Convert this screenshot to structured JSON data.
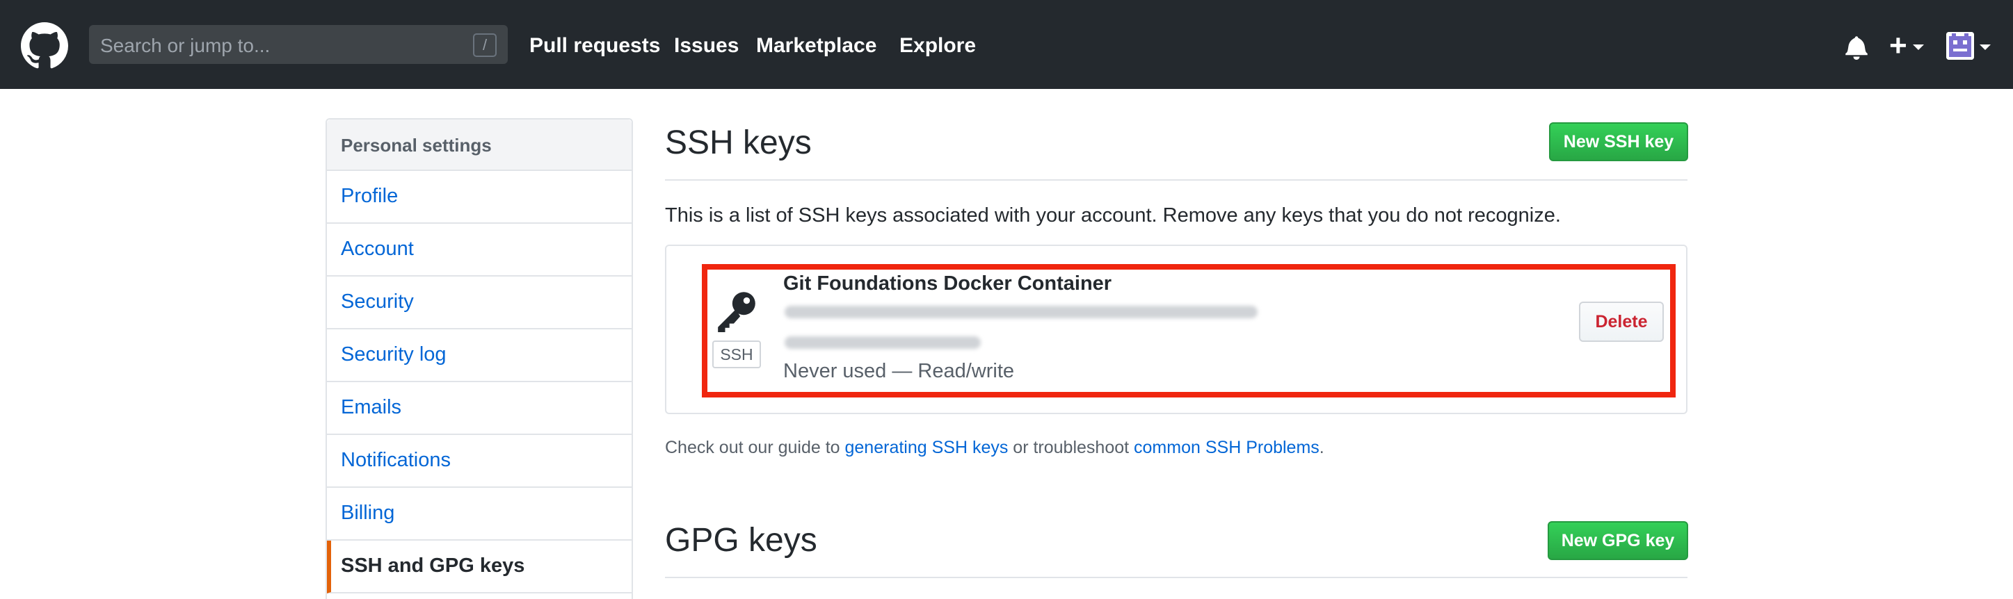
{
  "header": {
    "search_placeholder": "Search or jump to...",
    "search_shortcut": "/",
    "nav": [
      "Pull requests",
      "Issues",
      "Marketplace",
      "Explore"
    ],
    "plus_label": "+",
    "background": "#24292e"
  },
  "sidebar": {
    "heading": "Personal settings",
    "items": [
      {
        "label": "Profile",
        "selected": false
      },
      {
        "label": "Account",
        "selected": false
      },
      {
        "label": "Security",
        "selected": false
      },
      {
        "label": "Security log",
        "selected": false
      },
      {
        "label": "Emails",
        "selected": false
      },
      {
        "label": "Notifications",
        "selected": false
      },
      {
        "label": "Billing",
        "selected": false
      },
      {
        "label": "SSH and GPG keys",
        "selected": true
      }
    ],
    "selected_accent": "#e36209"
  },
  "ssh": {
    "title": "SSH keys",
    "new_button": "New SSH key",
    "description": "This is a list of SSH keys associated with your account. Remove any keys that you do not recognize.",
    "key": {
      "name": "Git Foundations Docker Container",
      "badge": "SSH",
      "usage": "Never used — Read/write",
      "delete_label": "Delete",
      "highlight_color": "#f0260f"
    },
    "guide": {
      "prefix": "Check out our guide to ",
      "link1": "generating SSH keys",
      "middle": " or troubleshoot ",
      "link2": "common SSH Problems",
      "suffix": "."
    }
  },
  "gpg": {
    "title": "GPG keys",
    "new_button": "New GPG key"
  },
  "colors": {
    "link": "#0366d6",
    "primary_button": "#28a745",
    "danger": "#cb2431"
  }
}
